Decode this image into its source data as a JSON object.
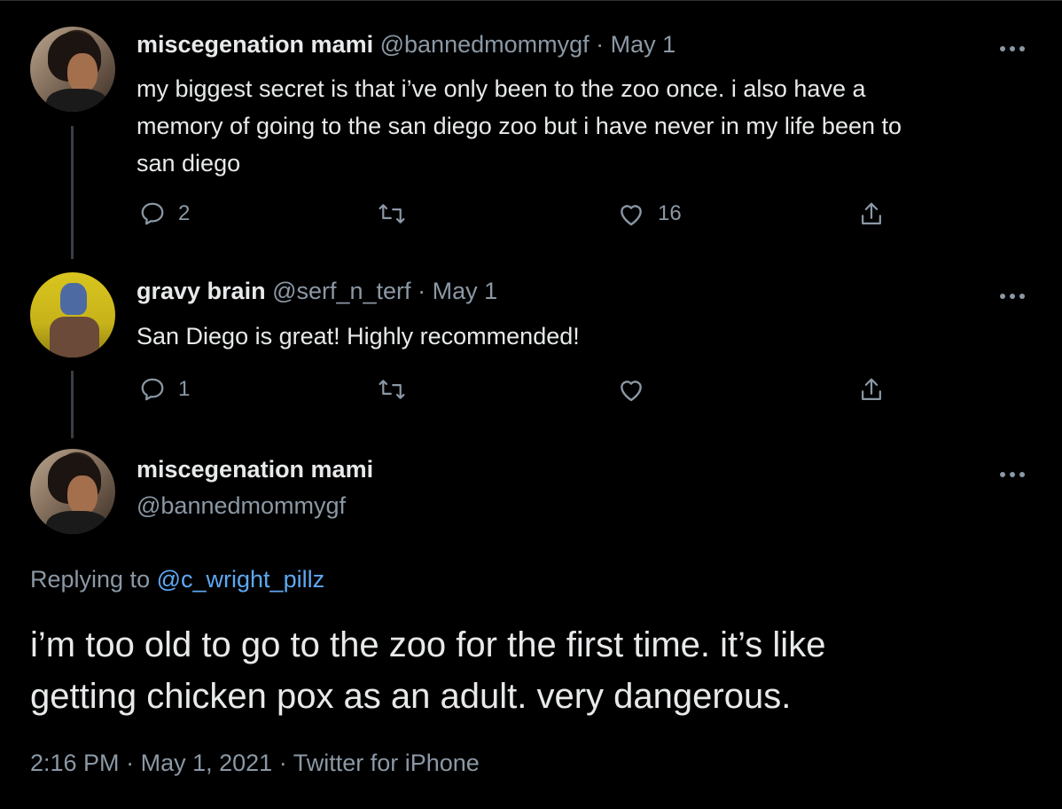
{
  "colors": {
    "background": "#000000",
    "text": "#e7e9ea",
    "muted": "#8b98a5",
    "link": "#5ea8f2",
    "thread_line": "#3a3f44"
  },
  "tweet1": {
    "name": "miscegenation mami",
    "handle": "@bannedmommygf",
    "separator": "·",
    "date": "May 1",
    "text_lines": [
      "my biggest secret is that i’ve only been to the zoo once. i also have a",
      "memory of going to the san diego zoo but i have never in my life been to",
      "san diego"
    ],
    "reply_count": "2",
    "like_count": "16",
    "icons": [
      "reply-icon",
      "retweet-icon",
      "like-icon",
      "share-icon",
      "more-icon"
    ]
  },
  "tweet2": {
    "name": "gravy brain",
    "handle": "@serf_n_terf",
    "separator": "·",
    "date": "May 1",
    "text": "San Diego is great! Highly recommended!",
    "reply_count": "1",
    "icons": [
      "reply-icon",
      "retweet-icon",
      "like-icon",
      "share-icon",
      "more-icon"
    ]
  },
  "main_tweet": {
    "name": "miscegenation mami",
    "handle": "@bannedmommygf",
    "replying_label": "Replying to",
    "replying_to": "@c_wright_pillz",
    "text_lines": [
      "i’m too old to go to the zoo for the first time. it’s like",
      "getting chicken pox as an adult. very dangerous."
    ],
    "time": "2:16 PM",
    "separator": "·",
    "date": "May 1, 2021",
    "source": "Twitter for iPhone"
  }
}
